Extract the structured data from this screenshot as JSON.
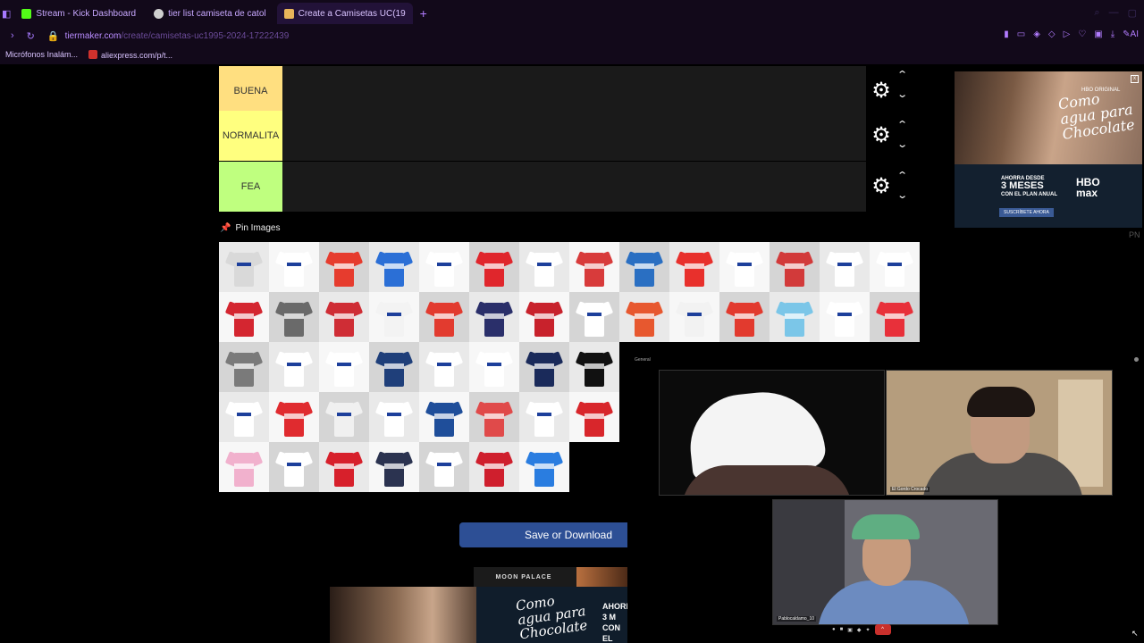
{
  "browser": {
    "tabs": [
      {
        "label": "Stream - Kick Dashboard",
        "icon_color": "#53fc18"
      },
      {
        "label": "tier list camiseta de catol",
        "icon_color": "#bbbbbb"
      },
      {
        "label": "Create a Camisetas UC(19",
        "icon_color": "#e8b55a"
      }
    ],
    "new_tab": "+",
    "url_domain": "tiermaker.com",
    "url_path": "/create/camisetas-uc1995-2024-17222439",
    "bookmarks": [
      "Micrófonos Inalám...",
      "aliexpress.com/p/t..."
    ]
  },
  "tiers": [
    {
      "label": "BUENA",
      "color": "#ffdf80"
    },
    {
      "label": "NORMALITA",
      "color": "#ffff7f"
    },
    {
      "label": "FEA",
      "color": "#bfff7f"
    }
  ],
  "pin_images_label": "Pin Images",
  "jerseys": [
    [
      "#d9d9d9",
      "#ffffff",
      "#e63c2e",
      "#2b6fd6",
      "#ffffff",
      "#e0262c",
      "#ffffff",
      "#d83b3b",
      "#2a6fc2",
      "#e8302c",
      "#ffffff",
      "#d23a3a",
      "#ffffff",
      "#ffffff"
    ],
    [
      "#d42630",
      "#6a6a6a",
      "#cf2d35",
      "#f3f3f3",
      "#e23b2f",
      "#2a2f6a",
      "#c8222c",
      "#ffffff",
      "#e7582f",
      "#f2f2f2",
      "#e23a2e",
      "#7bc6e8",
      "#ffffff",
      "#e8303a"
    ],
    [
      "#7a7a7a",
      "#ffffff",
      "#ffffff",
      "#1f3f7a",
      "#ffffff",
      "#ffffff",
      "#1a2a5a",
      "#111111"
    ],
    [
      "#ffffff",
      "#e02b2f",
      "#f0f0f0",
      "#ffffff",
      "#1f4e9a",
      "#e04a4a",
      "#ffffff",
      "#d8262b"
    ],
    [
      "#f1b1cd",
      "#ffffff",
      "#d7202b",
      "#2b3350",
      "#ffffff",
      "#cf1f2d",
      "#2a7de0"
    ]
  ],
  "save_button": "Save or Download",
  "ad_side": {
    "brand": "HBO ORIGINAL",
    "title": "Como agua para Chocolate",
    "promo_top": "AHORRA DESDE",
    "promo_big": "3 MESES",
    "promo_bottom": "CON EL PLAN ANUAL",
    "platform": "HBO max",
    "cta": "SUSCRÍBETE AHORA",
    "close": "x"
  },
  "pn_label": "PN",
  "ad_bottom": {
    "sponsor": "MOON PALACE",
    "title": "Como agua para Chocolate",
    "promo": "AHORR 3 M CON EL"
  },
  "call": {
    "title": "General",
    "participants": [
      "",
      "El Gordo Crocado",
      "Pablocaldamo_10"
    ],
    "hangup": "^"
  }
}
